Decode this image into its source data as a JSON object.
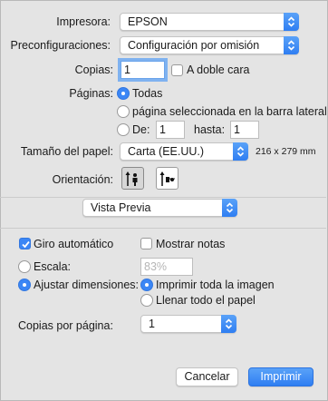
{
  "printer": {
    "label": "Impresora:",
    "value": "EPSON"
  },
  "presets": {
    "label": "Preconfiguraciones:",
    "value": "Configuración por omisión"
  },
  "copies": {
    "label": "Copias:",
    "value": "1",
    "duplex_label": "A doble cara",
    "duplex_checked": false
  },
  "pages": {
    "label": "Páginas:",
    "all_label": "Todas",
    "selection_label": "página seleccionada en la barra lateral",
    "from_label": "De:",
    "from_value": "1",
    "to_label": "hasta:",
    "to_value": "1",
    "selected": "all"
  },
  "paper_size": {
    "label": "Tamaño del papel:",
    "value": "Carta (EE.UU.)",
    "dimensions": "216 x 279 mm"
  },
  "orientation": {
    "label": "Orientación:",
    "selected": "portrait"
  },
  "app_menu": {
    "value": "Vista Previa"
  },
  "preview": {
    "auto_rotate_label": "Giro automático",
    "auto_rotate_checked": true,
    "show_notes_label": "Mostrar notas",
    "show_notes_checked": false,
    "scale_label": "Escala:",
    "scale_value": "83%",
    "fit_label": "Ajustar dimensiones:",
    "fit_selected": true,
    "print_entire_label": "Imprimir toda la imagen",
    "fill_paper_label": "Llenar todo el papel",
    "fit_option": "entire"
  },
  "pages_per_sheet": {
    "label": "Copias por página:",
    "value": "1"
  },
  "buttons": {
    "cancel": "Cancelar",
    "print": "Imprimir"
  },
  "colors": {
    "accent": "#3b86f5",
    "background": "#e4e4e4"
  }
}
